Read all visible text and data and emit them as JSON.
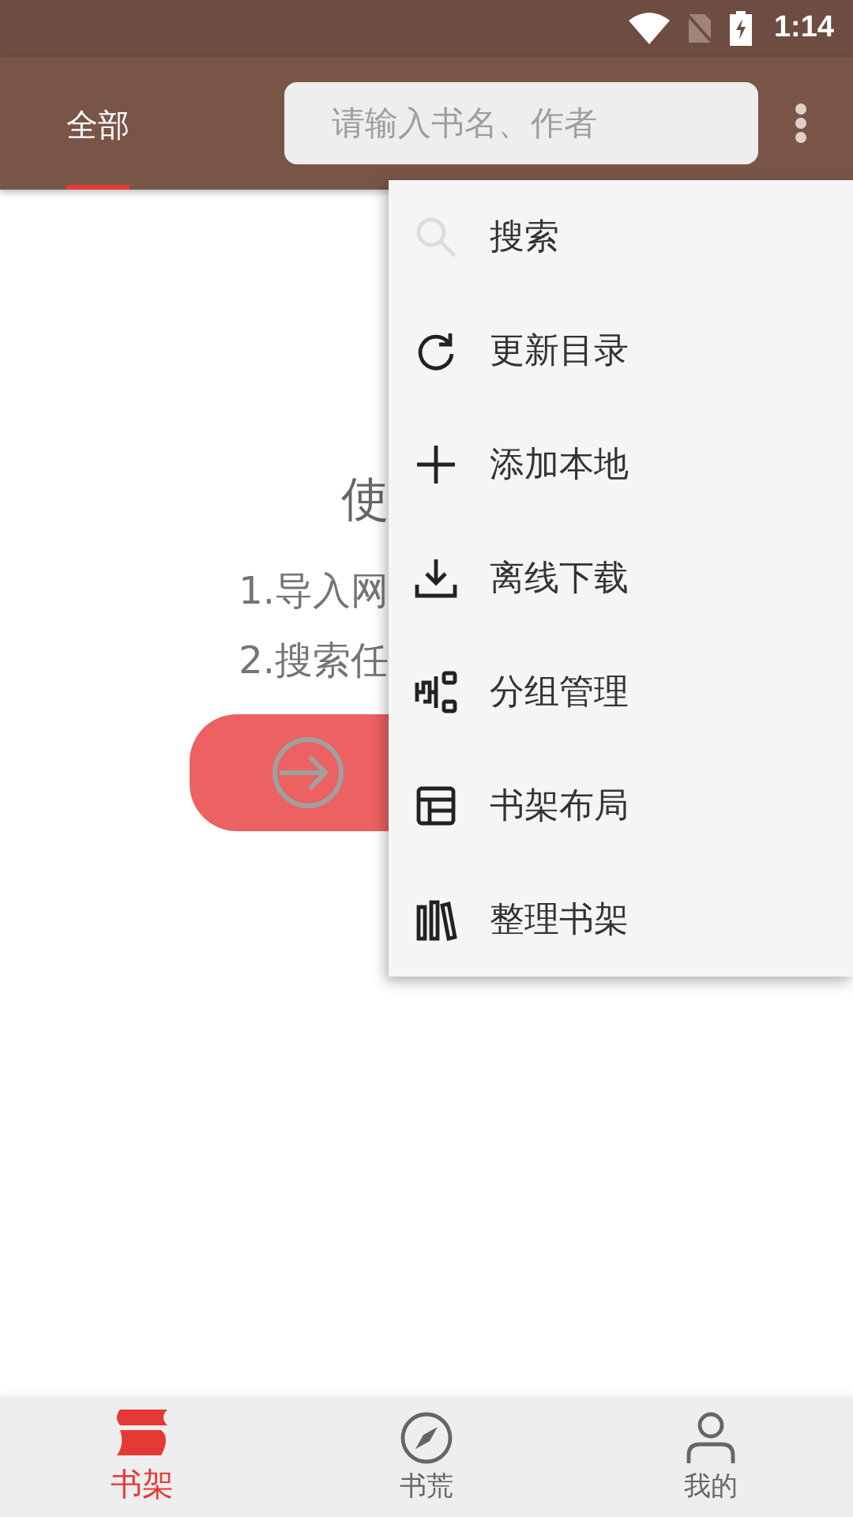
{
  "status_bar": {
    "time": "1:14"
  },
  "top_bar": {
    "tabs": [
      {
        "label": "全部",
        "selected": true
      }
    ],
    "search": {
      "placeholder": "请输入书名、作者"
    }
  },
  "empty_state": {
    "title": "使",
    "lines": [
      "1.导入网",
      "2.搜索任"
    ]
  },
  "menu": {
    "items": [
      {
        "kind": "search",
        "label": "搜索"
      },
      {
        "kind": "refresh",
        "label": "更新目录"
      },
      {
        "kind": "add",
        "label": "添加本地"
      },
      {
        "kind": "download",
        "label": "离线下载"
      },
      {
        "kind": "group",
        "label": "分组管理"
      },
      {
        "kind": "layout",
        "label": "书架布局"
      },
      {
        "kind": "arrange",
        "label": "整理书架"
      }
    ]
  },
  "bottom_nav": [
    {
      "kind": "shelf",
      "label": "书架",
      "selected": true
    },
    {
      "kind": "explore",
      "label": "书荒",
      "selected": false
    },
    {
      "kind": "profile",
      "label": "我的",
      "selected": false
    }
  ]
}
